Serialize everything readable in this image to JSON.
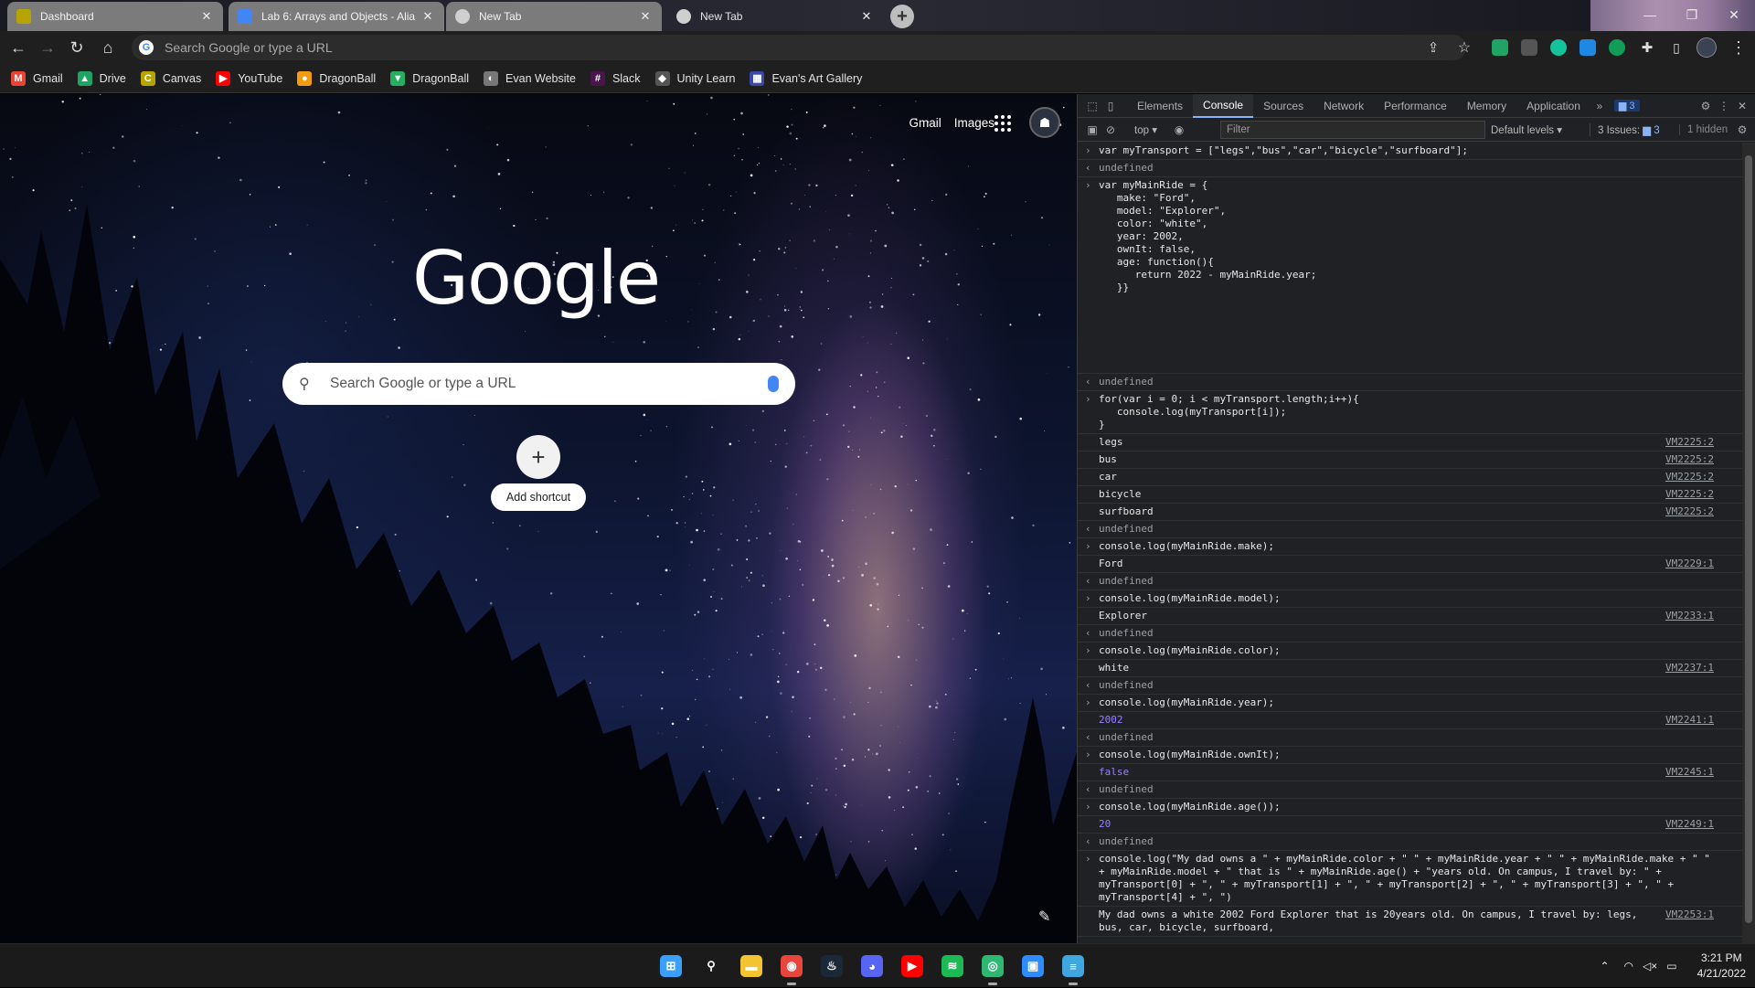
{
  "tabs": [
    {
      "title": "Dashboard",
      "favicon": "canvas-icon",
      "color": "#b8a400"
    },
    {
      "title": "Lab 6: Arrays and Objects - Alia",
      "favicon": "docs-icon",
      "color": "#4285f4"
    },
    {
      "title": "New Tab",
      "favicon": "chrome-icon",
      "color": "#cfcfcf"
    },
    {
      "title": "New Tab",
      "favicon": "chrome-icon",
      "color": "#cfcfcf"
    }
  ],
  "omnibox": {
    "placeholder": "Search Google or type a URL"
  },
  "bookmarks": [
    {
      "label": "Gmail",
      "icon": "gmail-icon",
      "color": "#ea4335",
      "glyph": "M"
    },
    {
      "label": "Drive",
      "icon": "drive-icon",
      "color": "#1fa463",
      "glyph": "▲"
    },
    {
      "label": "Canvas",
      "icon": "canvas-icon",
      "color": "#b8a400",
      "glyph": "C"
    },
    {
      "label": "YouTube",
      "icon": "youtube-icon",
      "color": "#ff0000",
      "glyph": "▶"
    },
    {
      "label": "DragonBall",
      "icon": "dragonball-icon",
      "color": "#f39c12",
      "glyph": "●"
    },
    {
      "label": "DragonBall",
      "icon": "dragonball-shield-icon",
      "color": "#27ae60",
      "glyph": "▼"
    },
    {
      "label": "Evan Website",
      "icon": "globe-icon",
      "color": "#777777",
      "glyph": "◐"
    },
    {
      "label": "Slack",
      "icon": "slack-icon",
      "color": "#4a154b",
      "glyph": "#"
    },
    {
      "label": "Unity Learn",
      "icon": "unity-icon",
      "color": "#555555",
      "glyph": "◆"
    },
    {
      "label": "Evan's Art Gallery",
      "icon": "gallery-icon",
      "color": "#3949ab",
      "glyph": "▦"
    }
  ],
  "newtab": {
    "links": [
      "Gmail",
      "Images"
    ],
    "logo": "Google",
    "search_placeholder": "Search Google or type a URL",
    "add_shortcut": "Add shortcut"
  },
  "devtools": {
    "tabs": [
      "Elements",
      "Console",
      "Sources",
      "Network",
      "Performance",
      "Memory",
      "Application"
    ],
    "selected_tab": "Console",
    "issues_badge": "3",
    "context": "top",
    "filter_placeholder": "Filter",
    "levels": "Default levels",
    "issues": "3 Issues:",
    "issues_count": "3",
    "hidden": "1 hidden"
  },
  "console": [
    {
      "kind": "in",
      "lines": [
        "var myTransport = [\"legs\",\"bus\",\"car\",\"bicycle\",\"surfboard\"];"
      ]
    },
    {
      "kind": "res",
      "lines": [
        "undefined"
      ]
    },
    {
      "kind": "in",
      "lines": [
        "var myMainRide = {",
        "   make: \"Ford\",",
        "   model: \"Explorer\",",
        "   color: \"white\",",
        "   year: 2002,",
        "   ownIt: false,",
        "   age: function(){",
        "      return 2022 - myMainRide.year;",
        "   }}",
        "",
        "",
        "",
        "",
        "",
        ""
      ]
    },
    {
      "kind": "res",
      "lines": [
        "undefined"
      ]
    },
    {
      "kind": "in",
      "lines": [
        "for(var i = 0; i < myTransport.length;i++){",
        "   console.log(myTransport[i]);",
        "}"
      ]
    },
    {
      "kind": "log",
      "lines": [
        "legs"
      ],
      "src": "VM2225:2"
    },
    {
      "kind": "log",
      "lines": [
        "bus"
      ],
      "src": "VM2225:2"
    },
    {
      "kind": "log",
      "lines": [
        "car"
      ],
      "src": "VM2225:2"
    },
    {
      "kind": "log",
      "lines": [
        "bicycle"
      ],
      "src": "VM2225:2"
    },
    {
      "kind": "log",
      "lines": [
        "surfboard"
      ],
      "src": "VM2225:2"
    },
    {
      "kind": "res",
      "lines": [
        "undefined"
      ]
    },
    {
      "kind": "in",
      "lines": [
        "console.log(myMainRide.make);"
      ]
    },
    {
      "kind": "log",
      "lines": [
        "Ford"
      ],
      "src": "VM2229:1"
    },
    {
      "kind": "res",
      "lines": [
        "undefined"
      ]
    },
    {
      "kind": "in",
      "lines": [
        "console.log(myMainRide.model);"
      ]
    },
    {
      "kind": "log",
      "lines": [
        "Explorer"
      ],
      "src": "VM2233:1"
    },
    {
      "kind": "res",
      "lines": [
        "undefined"
      ]
    },
    {
      "kind": "in",
      "lines": [
        "console.log(myMainRide.color);"
      ]
    },
    {
      "kind": "log",
      "lines": [
        "white"
      ],
      "src": "VM2237:1"
    },
    {
      "kind": "res",
      "lines": [
        "undefined"
      ]
    },
    {
      "kind": "in",
      "lines": [
        "console.log(myMainRide.year);"
      ]
    },
    {
      "kind": "num",
      "lines": [
        "2002"
      ],
      "src": "VM2241:1"
    },
    {
      "kind": "res",
      "lines": [
        "undefined"
      ]
    },
    {
      "kind": "in",
      "lines": [
        "console.log(myMainRide.ownIt);"
      ]
    },
    {
      "kind": "num",
      "lines": [
        "false"
      ],
      "src": "VM2245:1"
    },
    {
      "kind": "res",
      "lines": [
        "undefined"
      ]
    },
    {
      "kind": "in",
      "lines": [
        "console.log(myMainRide.age());"
      ]
    },
    {
      "kind": "num",
      "lines": [
        "20"
      ],
      "src": "VM2249:1"
    },
    {
      "kind": "res",
      "lines": [
        "undefined"
      ]
    },
    {
      "kind": "in",
      "lines": [
        "console.log(\"My dad owns a \" + myMainRide.color + \" \" + myMainRide.year + \" \" + myMainRide.make + \" \"",
        "+ myMainRide.model + \" that is \" + myMainRide.age() + \"years old. On campus, I travel by: \" +",
        "myTransport[0] + \", \" + myTransport[1] + \", \" + myTransport[2] + \", \" + myTransport[3] + \", \" +",
        "myTransport[4] + \", \")"
      ]
    },
    {
      "kind": "log",
      "lines": [
        "My dad owns a white 2002 Ford Explorer that is 20years old. On campus, I travel by: legs,",
        "bus, car, bicycle, surfboard,"
      ],
      "src": "VM2253:1"
    }
  ],
  "taskbar": {
    "apps": [
      {
        "name": "windows-start-icon",
        "color": "#3aa0ff",
        "glyph": "⊞"
      },
      {
        "name": "search-icon",
        "color": "transparent",
        "glyph": "⚲"
      },
      {
        "name": "file-explorer-icon",
        "color": "#f4c430",
        "glyph": "▬"
      },
      {
        "name": "chrome-icon",
        "color": "#e8453c",
        "glyph": "◉",
        "running": true
      },
      {
        "name": "steam-icon",
        "color": "#1b2838",
        "glyph": "♨"
      },
      {
        "name": "discord-icon",
        "color": "#5865f2",
        "glyph": "◕"
      },
      {
        "name": "youtube-music-icon",
        "color": "#ff0000",
        "glyph": "▶"
      },
      {
        "name": "spotify-icon",
        "color": "#1db954",
        "glyph": "≋"
      },
      {
        "name": "edge-canary-icon",
        "color": "#2eb872",
        "glyph": "◎",
        "running": true
      },
      {
        "name": "zoom-icon",
        "color": "#2d8cff",
        "glyph": "▣"
      },
      {
        "name": "notepad-icon",
        "color": "#40a6e0",
        "glyph": "≡",
        "running": true
      }
    ],
    "time": "3:21 PM",
    "date": "4/21/2022"
  }
}
